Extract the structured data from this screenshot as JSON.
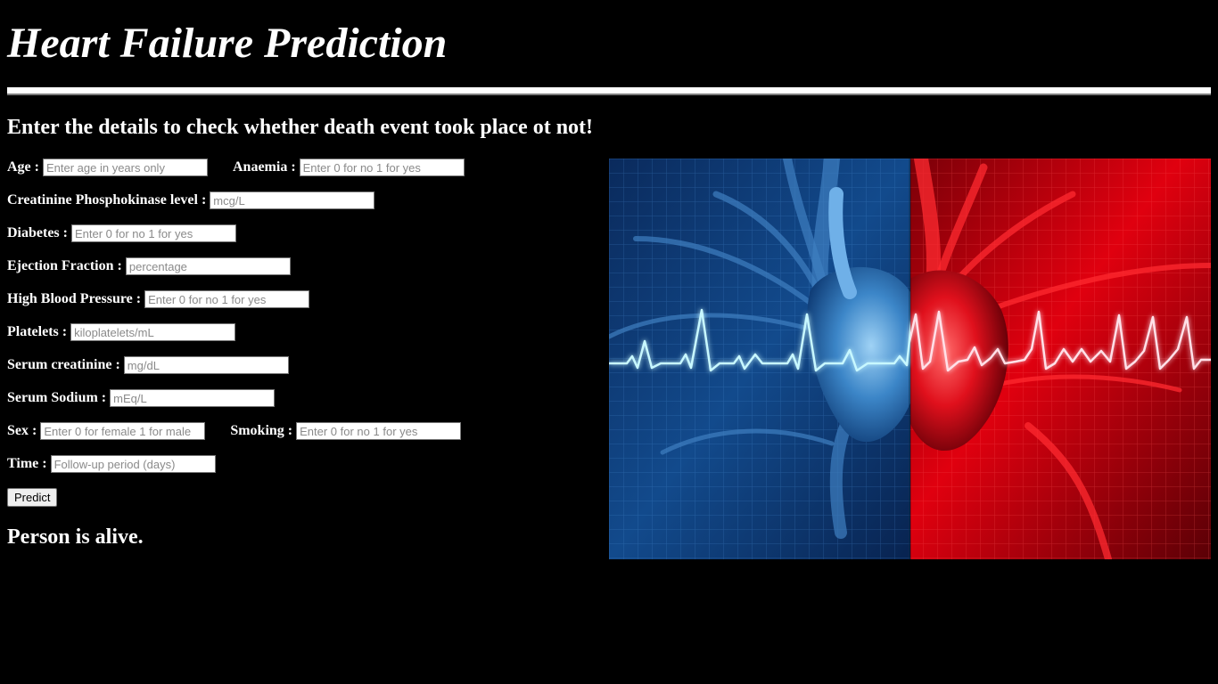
{
  "header": {
    "title": "Heart Failure Prediction",
    "subtitle": "Enter the details to check whether death event took place ot not!"
  },
  "form": {
    "age": {
      "label": "Age :",
      "placeholder": "Enter age in years only"
    },
    "anaemia": {
      "label": "Anaemia :",
      "placeholder": "Enter 0 for no 1 for yes"
    },
    "cpk": {
      "label": "Creatinine Phosphokinase level :",
      "placeholder": "mcg/L"
    },
    "diabetes": {
      "label": "Diabetes :",
      "placeholder": "Enter 0 for no 1 for yes"
    },
    "ejection": {
      "label": "Ejection Fraction :",
      "placeholder": "percentage"
    },
    "hbp": {
      "label": "High Blood Pressure :",
      "placeholder": "Enter 0 for no 1 for yes"
    },
    "platelets": {
      "label": "Platelets :",
      "placeholder": "kiloplatelets/mL"
    },
    "creatinine": {
      "label": "Serum creatinine :",
      "placeholder": "mg/dL"
    },
    "sodium": {
      "label": "Serum Sodium :",
      "placeholder": "mEq/L"
    },
    "sex": {
      "label": "Sex :",
      "placeholder": "Enter 0 for female 1 for male"
    },
    "smoking": {
      "label": "Smoking :",
      "placeholder": "Enter 0 for no 1 for yes"
    },
    "time": {
      "label": "Time :",
      "placeholder": "Follow-up period (days)"
    },
    "predict_label": "Predict"
  },
  "result": {
    "text": "Person is alive."
  },
  "image": {
    "name": "heart-ecg-illustration",
    "colors": {
      "left": "#0b3a7a",
      "right": "#d00010",
      "ecg_left": "#bff6ff",
      "ecg_right": "#ffd0dc"
    }
  }
}
